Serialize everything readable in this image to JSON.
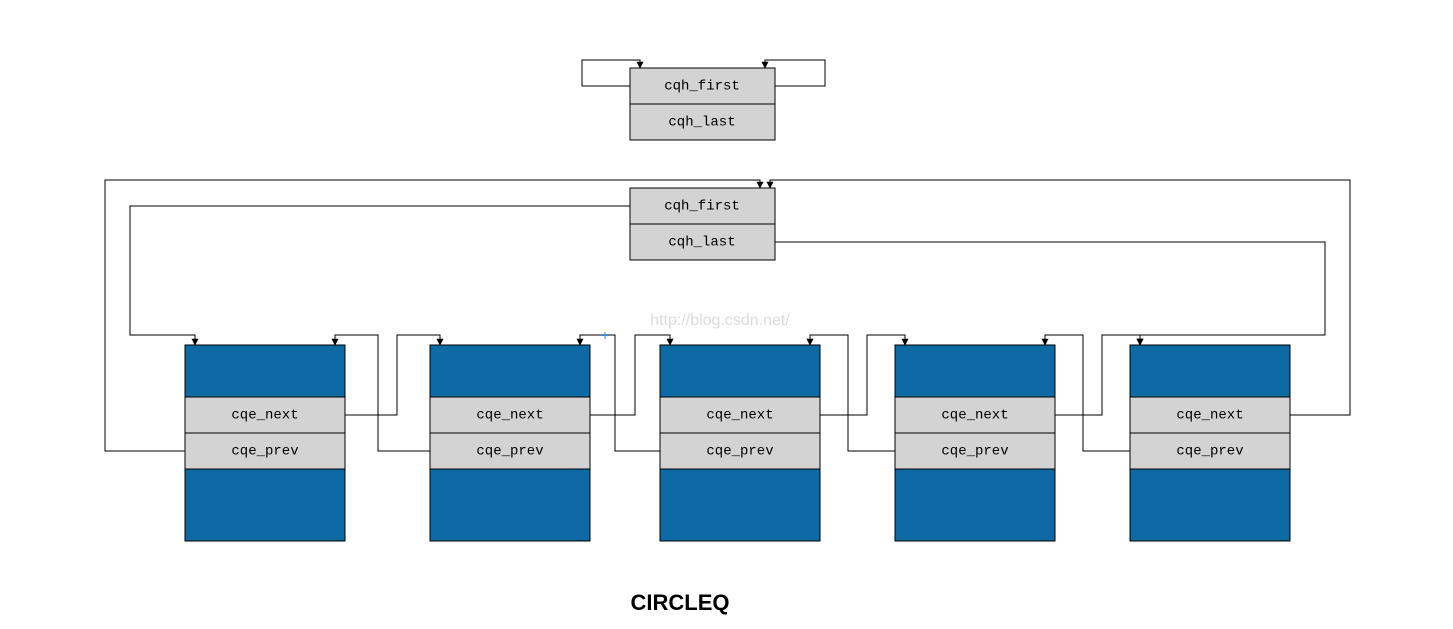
{
  "title": "CIRCLEQ",
  "watermark": "http://blog.csdn.net/",
  "head_empty": {
    "first": "cqh_first",
    "last": "cqh_last"
  },
  "head_full": {
    "first": "cqh_first",
    "last": "cqh_last"
  },
  "nodes": [
    {
      "next": "cqe_next",
      "prev": "cqe_prev"
    },
    {
      "next": "cqe_next",
      "prev": "cqe_prev"
    },
    {
      "next": "cqe_next",
      "prev": "cqe_prev"
    },
    {
      "next": "cqe_next",
      "prev": "cqe_prev"
    },
    {
      "next": "cqe_next",
      "prev": "cqe_prev"
    }
  ],
  "colors": {
    "node": "#0d6aa4",
    "box": "#d3d3d3",
    "line": "#000000",
    "bg": "#ffffff"
  }
}
